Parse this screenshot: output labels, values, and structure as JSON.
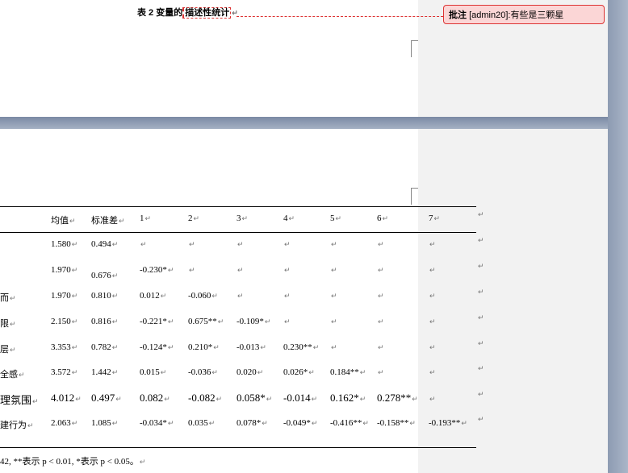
{
  "caption": {
    "prefix": "表 2  变量的",
    "highlight": "描述性统计",
    "mark": "↵"
  },
  "comment": {
    "label": "批注",
    "author": "[admin20]:",
    "text": "有些是三颗星"
  },
  "table": {
    "headers": [
      "均值",
      "标准差",
      "1",
      "2",
      "3",
      "4",
      "5",
      "6",
      "7"
    ],
    "row_labels": [
      "",
      "",
      "而",
      "限",
      "层",
      "全感",
      "理氛围",
      "建行为"
    ],
    "rows": [
      [
        "1.580",
        "0.494",
        "",
        "",
        "",
        "",
        "",
        "",
        ""
      ],
      [
        "1.970",
        "0.676",
        "-0.230*",
        "",
        "",
        "",
        "",
        "",
        ""
      ],
      [
        "1.970",
        "0.810",
        "0.012",
        "-0.060",
        "",
        "",
        "",
        "",
        ""
      ],
      [
        "2.150",
        "0.816",
        "-0.221*",
        "0.675**",
        "-0.109*",
        "",
        "",
        "",
        ""
      ],
      [
        "3.353",
        "0.782",
        "-0.124*",
        "0.210*",
        "-0.013",
        "0.230**",
        "",
        "",
        ""
      ],
      [
        "3.572",
        "1.442",
        "0.015",
        "-0.036",
        "0.020",
        "0.026*",
        "0.184**",
        "",
        ""
      ],
      [
        "4.012",
        "0.497",
        "0.082",
        "-0.082",
        "0.058*",
        "-0.014",
        "0.162*",
        "0.278**",
        ""
      ],
      [
        "2.063",
        "1.085",
        "-0.034*",
        "0.035",
        "0.078*",
        "-0.049*",
        "-0.416**",
        "-0.158**",
        "-0.193**"
      ]
    ],
    "note": "42, **表示 p < 0.01, *表示 p < 0.05。"
  },
  "para_mark": "↵",
  "colors": {
    "comment_border": "#dd3333",
    "comment_fill": "#fbd6d6",
    "canvas": "#9aa7bb"
  }
}
